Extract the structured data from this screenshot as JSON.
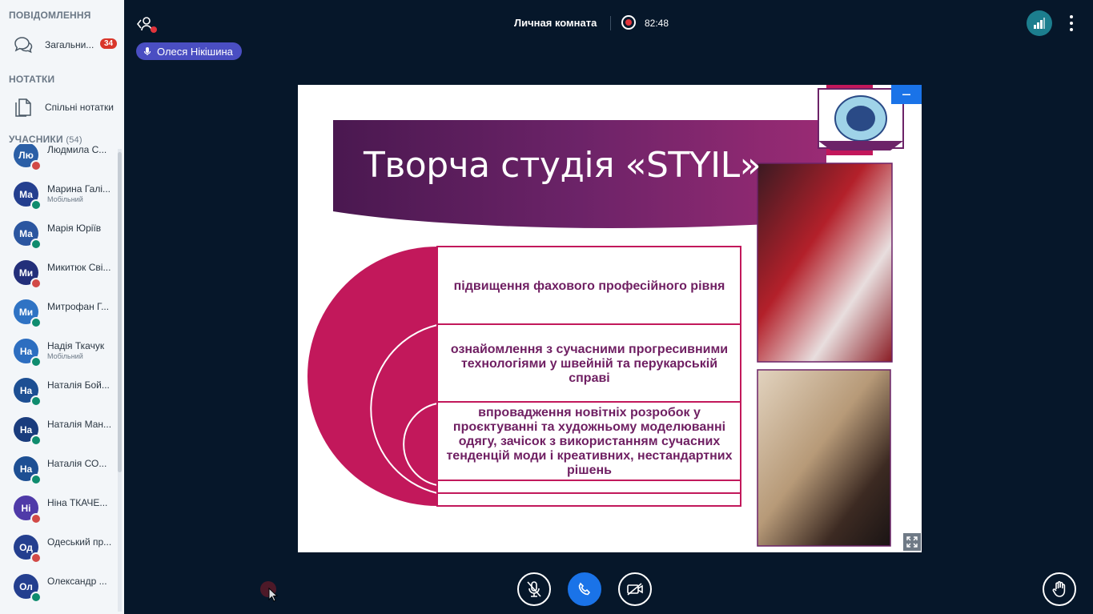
{
  "sidebar": {
    "messages_title": "ПОВІДОМЛЕННЯ",
    "public_chat_label": "Загальни...",
    "public_chat_badge": "34",
    "notes_title": "НОТАТКИ",
    "shared_notes_label": "Спільні нотатки",
    "users_title": "УЧАСНИКИ",
    "users_count": "(54)",
    "users": [
      {
        "initials": "Лю",
        "name": "Людмила С...",
        "sub": "",
        "status": "muted"
      },
      {
        "initials": "Ма",
        "name": "Марина Галі...",
        "sub": "Мобільний",
        "status": "listen"
      },
      {
        "initials": "Ма",
        "name": "Марія Юріїв",
        "sub": "",
        "status": "listen"
      },
      {
        "initials": "Ми",
        "name": "Микитюк Сві...",
        "sub": "",
        "status": "muted"
      },
      {
        "initials": "Ми",
        "name": "Митрофан Г...",
        "sub": "",
        "status": "listen"
      },
      {
        "initials": "На",
        "name": "Надія Ткачук",
        "sub": "Мобільний",
        "status": "listen"
      },
      {
        "initials": "На",
        "name": "Наталія Бой...",
        "sub": "",
        "status": "listen"
      },
      {
        "initials": "На",
        "name": "Наталія Ман...",
        "sub": "",
        "status": "listen"
      },
      {
        "initials": "На",
        "name": "Наталія СО...",
        "sub": "",
        "status": "listen"
      },
      {
        "initials": "Ні",
        "name": "Ніна ТКАЧЕ...",
        "sub": "",
        "status": "muted"
      },
      {
        "initials": "Од",
        "name": "Одеський пр...",
        "sub": "",
        "status": "muted"
      },
      {
        "initials": "Ол",
        "name": "Олександр ...",
        "sub": "",
        "status": "listen"
      }
    ]
  },
  "topbar": {
    "room_title": "Личная комната",
    "recording_time": "82:48",
    "talking_user": "Олеся Нікішина"
  },
  "slide": {
    "title": "Творча студія «STYIL»",
    "items": [
      "підвищення фахового професійного рівня",
      "ознайомлення з сучасними прогресивними технологіями у швейній та перукарській справі",
      "впровадження новітніх розробок у проєктуванні та художньому моделюванні одягу, зачісок з використанням сучасних тенденцій моди і креативних, нестандартних рішень"
    ]
  },
  "colors": {
    "accent": "#1a73e8",
    "slide_magenta": "#c2185b",
    "slide_purple": "#6f1f62",
    "background": "#06172a"
  },
  "icons": {
    "chat": "chat-icon",
    "notes": "notes-icon",
    "mute": "microphone-off-icon",
    "hangup": "phone-icon",
    "video": "video-off-icon",
    "raise_hand": "hand-icon"
  }
}
